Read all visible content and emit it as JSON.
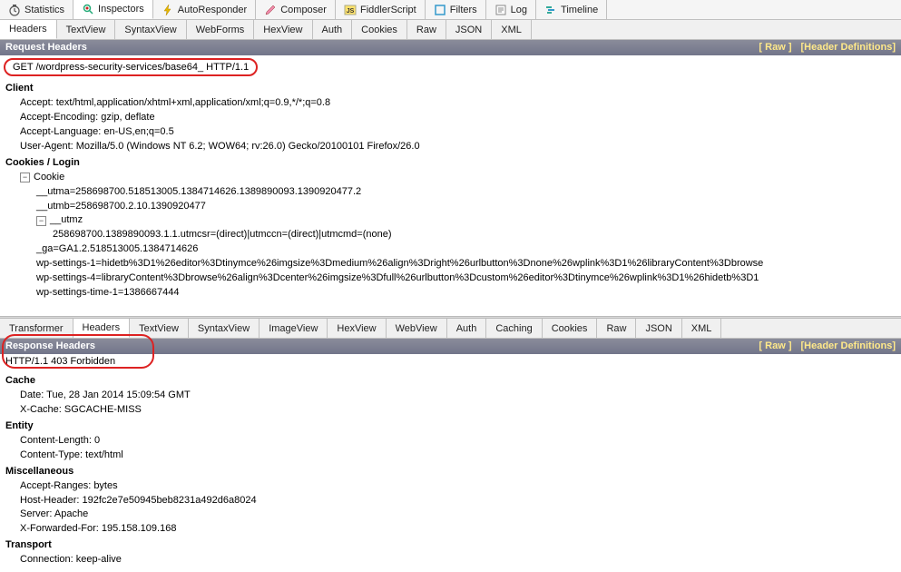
{
  "toolbar_tabs": [
    {
      "label": "Statistics",
      "icon": "timer"
    },
    {
      "label": "Inspectors",
      "icon": "inspector",
      "active": true
    },
    {
      "label": "AutoResponder",
      "icon": "flash"
    },
    {
      "label": "Composer",
      "icon": "pencil"
    },
    {
      "label": "FiddlerScript",
      "icon": "js"
    },
    {
      "label": "Filters",
      "icon": "filter"
    },
    {
      "label": "Log",
      "icon": "log"
    },
    {
      "label": "Timeline",
      "icon": "timeline"
    }
  ],
  "request_subtabs": [
    "Headers",
    "TextView",
    "SyntaxView",
    "WebForms",
    "HexView",
    "Auth",
    "Cookies",
    "Raw",
    "JSON",
    "XML"
  ],
  "request_subtabs_active": 0,
  "request": {
    "panel_title": "Request Headers",
    "links": {
      "raw": "[ Raw ]",
      "defs": "[Header Definitions]"
    },
    "request_line": "GET /wordpress-security-services/base64_ HTTP/1.1",
    "sections": [
      {
        "title": "Client",
        "rows": [
          "Accept: text/html,application/xhtml+xml,application/xml;q=0.9,*/*;q=0.8",
          "Accept-Encoding: gzip, deflate",
          "Accept-Language: en-US,en;q=0.5",
          "User-Agent: Mozilla/5.0 (Windows NT 6.2; WOW64; rv:26.0) Gecko/20100101 Firefox/26.0"
        ]
      },
      {
        "title": "Cookies / Login",
        "cookie_tree": {
          "root": "Cookie",
          "items": [
            "__utma=258698700.518513005.1384714626.1389890093.1390920477.2",
            "__utmb=258698700.2.10.1390920477"
          ],
          "sub": {
            "name": "__utmz",
            "child": "258698700.1389890093.1.1.utmcsr=(direct)|utmccn=(direct)|utmcmd=(none)"
          },
          "more": [
            "_ga=GA1.2.518513005.1384714626",
            "wp-settings-1=hidetb%3D1%26editor%3Dtinymce%26imgsize%3Dmedium%26align%3Dright%26urlbutton%3Dnone%26wplink%3D1%26libraryContent%3Dbrowse",
            "wp-settings-4=libraryContent%3Dbrowse%26align%3Dcenter%26imgsize%3Dfull%26urlbutton%3Dcustom%26editor%3Dtinymce%26wplink%3D1%26hidetb%3D1",
            "wp-settings-time-1=1386667444"
          ]
        }
      }
    ]
  },
  "response_subtabs": [
    "Transformer",
    "Headers",
    "TextView",
    "SyntaxView",
    "ImageView",
    "HexView",
    "WebView",
    "Auth",
    "Caching",
    "Cookies",
    "Raw",
    "JSON",
    "XML"
  ],
  "response_subtabs_active": 1,
  "response": {
    "panel_title": "Response Headers",
    "links": {
      "raw": "[ Raw ]",
      "defs": "[Header Definitions]"
    },
    "status_line": "HTTP/1.1 403 Forbidden",
    "sections": [
      {
        "title": "Cache",
        "rows": [
          "Date: Tue, 28 Jan 2014 15:09:54 GMT",
          "X-Cache: SGCACHE-MISS"
        ]
      },
      {
        "title": "Entity",
        "rows": [
          "Content-Length: 0",
          "Content-Type: text/html"
        ]
      },
      {
        "title": "Miscellaneous",
        "rows": [
          "Accept-Ranges: bytes",
          "Host-Header: 192fc2e7e50945beb8231a492d6a8024",
          "Server: Apache",
          "X-Forwarded-For: 195.158.109.168"
        ]
      },
      {
        "title": "Transport",
        "rows": [
          "Connection: keep-alive"
        ]
      }
    ]
  }
}
